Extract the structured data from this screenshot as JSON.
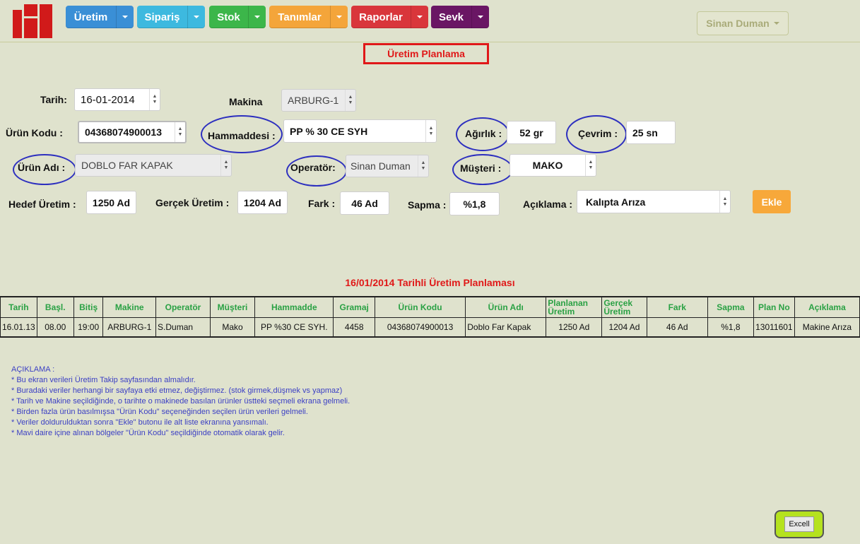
{
  "colors": {
    "background": "#dfe2cd",
    "uretim": "#3a8fd6",
    "siparis": "#3db9df",
    "stok": "#3cb64a",
    "tanimlar": "#f4a53a",
    "raporlar": "#d9363b",
    "sevk": "#6a1664",
    "title_red": "#e01818",
    "header_green": "#2aa144",
    "highlight_ellipse": "#2d2fbf",
    "note_blue": "#3b3fc4"
  },
  "nav": {
    "items": [
      {
        "label": "Üretim"
      },
      {
        "label": "Sipariş"
      },
      {
        "label": "Stok"
      },
      {
        "label": "Tanımlar"
      },
      {
        "label": "Raporlar"
      },
      {
        "label": "Sevk"
      }
    ],
    "user": "Sinan Duman"
  },
  "page_title": "Üretim Planlama",
  "form": {
    "tarih_label": "Tarih:",
    "tarih_value": "16-01-2014",
    "makina_label": "Makina",
    "makina_value": "ARBURG-1",
    "urun_kodu_label": "Ürün Kodu :",
    "urun_kodu_value": "04368074900013",
    "hammadde_label": "Hammaddesi :",
    "hammadde_value": "PP % 30 CE SYH",
    "agirlik_label": "Ağırlık :",
    "agirlik_value": "52 gr",
    "cevrim_label": "Çevrim :",
    "cevrim_value": "25 sn",
    "urun_adi_label": "Ürün Adı :",
    "urun_adi_value": "DOBLO FAR KAPAK",
    "operator_label": "Operatör:",
    "operator_value": "Sinan Duman",
    "musteri_label": "Müşteri :",
    "musteri_value": "MAKO",
    "hedef_label": "Hedef Üretim :",
    "hedef_value": "1250 Ad",
    "gercek_label": "Gerçek Üretim :",
    "gercek_value": "1204 Ad",
    "fark_label": "Fark :",
    "fark_value": "46 Ad",
    "sapma_label": "Sapma :",
    "sapma_value": "%1,8",
    "aciklama_label": "Açıklama :",
    "aciklama_value": "Kalıpta Arıza",
    "ekle_label": "Ekle"
  },
  "table": {
    "title": "16/01/2014 Tarihli Üretim Planlaması",
    "headers": [
      "Tarih",
      "Başl.",
      "Bitiş",
      "Makine",
      "Operatör",
      "Müşteri",
      "Hammadde",
      "Gramaj",
      "Ürün  Kodu",
      "Ürün Adı",
      "Planlanan Üretim",
      "Gerçek Üretim",
      "Fark",
      "Sapma",
      "Plan No",
      "Açıklama"
    ],
    "rows": [
      [
        "16.01.13",
        "08.00",
        "19:00",
        "ARBURG-1",
        "S.Duman",
        "Mako",
        "PP %30 CE SYH.",
        "4458",
        "04368074900013",
        "Doblo Far  Kapak",
        "1250 Ad",
        "1204 Ad",
        "46 Ad",
        "%1,8",
        "13011601",
        "Makine Arıza"
      ]
    ]
  },
  "notes": [
    "AÇIKLAMA :",
    "* Bu ekran verileri Üretim Takip sayfasından almalıdır.",
    "* Buradaki veriler herhangi bir sayfaya etki etmez, değiştirmez. (stok girmek,düşmek vs yapmaz)",
    "* Tarih ve Makine seçildiğinde, o tarihte o makinede basılan ürünler üstteki seçmeli ekrana gelmeli.",
    "* Birden fazla ürün basılmışsa \"Ürün Kodu\" seçeneğinden seçilen ürün verileri gelmeli.",
    "* Veriler doldurulduktan sonra \"Ekle\" butonu ile alt liste ekranına yansımalı.",
    "* Mavi daire içine alınan bölgeler \"Ürün Kodu\" seçildiğinde otomatik olarak gelir."
  ],
  "excel_label": "Excell"
}
